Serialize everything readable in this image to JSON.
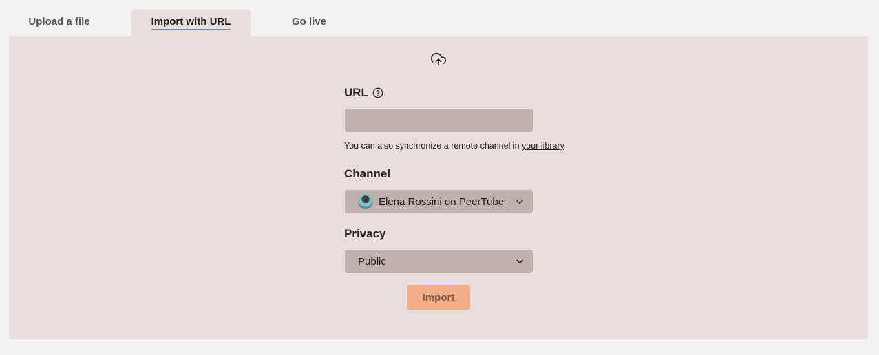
{
  "tabs": {
    "upload": "Upload a file",
    "url": "Import with URL",
    "live": "Go live"
  },
  "form": {
    "upload_icon": "cloud-upload-icon",
    "url_label": "URL",
    "help_icon": "help-circle-icon",
    "url_value": "",
    "hint_text": "You can also synchronize a remote channel in ",
    "hint_link": "your library",
    "channel_label": "Channel",
    "channel_value": "Elena Rossini on PeerTube",
    "privacy_label": "Privacy",
    "privacy_value": "Public",
    "import_button": "Import"
  },
  "colors": {
    "accent": "#e36a1f",
    "button_disabled": "#f1ad85",
    "panel_bg": "#e7dedd",
    "input_bg": "#c0b0af"
  }
}
